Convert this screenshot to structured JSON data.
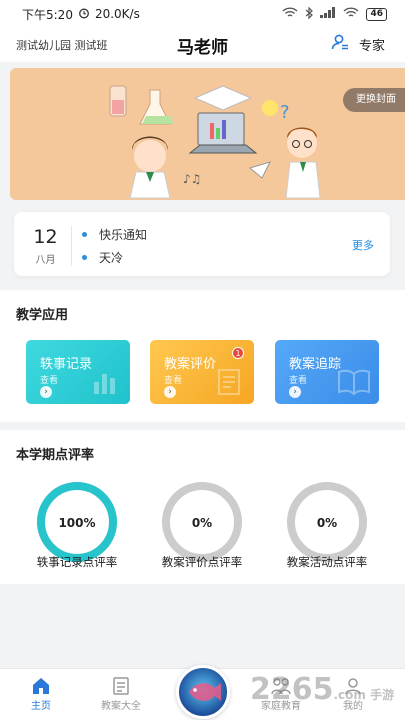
{
  "status_bar": {
    "time": "下午5:20",
    "speed": "20.0K/s",
    "battery": "46"
  },
  "header": {
    "school": "测试幼儿园 测试班",
    "title": "马老师",
    "expert_label": "专家"
  },
  "banner": {
    "change_cover_label": "更换封面"
  },
  "notice": {
    "day": "12",
    "month": "八月",
    "items": [
      "快乐通知",
      "天冷"
    ],
    "more_label": "更多"
  },
  "teaching_apps": {
    "title": "教学应用",
    "cards": [
      {
        "label": "轶事记录",
        "sub": "查看",
        "color": "#2ecfd7",
        "icon": "bar-chart-icon"
      },
      {
        "label": "教案评价",
        "sub": "查看",
        "color": "#f8b73a",
        "icon": "edit-note-icon",
        "badge": "1"
      },
      {
        "label": "教案追踪",
        "sub": "查看",
        "color": "#3e9bf2",
        "icon": "book-icon"
      }
    ]
  },
  "rates": {
    "title": "本学期点评率",
    "items": [
      {
        "label": "轶事记录点评率",
        "value_text": "100%",
        "value": 100,
        "color": "#28c4cc"
      },
      {
        "label": "教案评价点评率",
        "value_text": "0%",
        "value": 0,
        "color": "#cccccc"
      },
      {
        "label": "教案活动点评率",
        "value_text": "0%",
        "value": 0,
        "color": "#cccccc"
      }
    ]
  },
  "tabbar": {
    "items": [
      {
        "label": "主页",
        "icon": "home-icon",
        "active": true
      },
      {
        "label": "教案大全",
        "icon": "document-icon",
        "active": false
      },
      {
        "label": "家庭教育",
        "icon": "family-icon",
        "active": false
      },
      {
        "label": "我的",
        "icon": "user-icon",
        "active": false
      }
    ],
    "center_icon": "fish-logo-icon"
  },
  "colors": {
    "accent": "#2a79d8",
    "link": "#1f8ce0"
  },
  "watermark": {
    "text": "2265",
    "suffix": ".com 手游网"
  }
}
